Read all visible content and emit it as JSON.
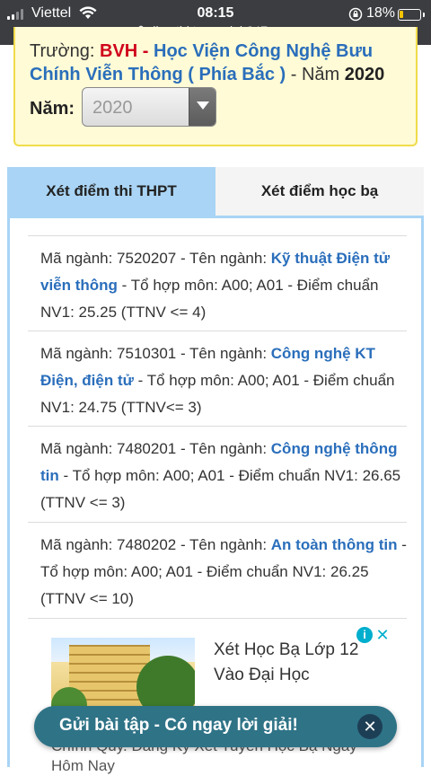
{
  "status_bar": {
    "carrier": "Viettel",
    "time": "08:15",
    "battery_percent": "18%",
    "battery_level": 0.18,
    "url": "diemthi.tuyensinh247.com"
  },
  "school": {
    "prefix": "Trường: ",
    "code": "BVH",
    "sep": " - ",
    "name": "Học Viện Công Nghệ Bưu Chính Viễn Thông ( Phía Bắc )",
    "year_prefix": " - Năm ",
    "year": "2020"
  },
  "year_select": {
    "label": "Năm:",
    "value": "2020"
  },
  "tabs": [
    {
      "label": "Xét điểm thi THPT",
      "active": true
    },
    {
      "label": "Xét điểm học bạ",
      "active": false
    }
  ],
  "majors": [
    {
      "code_text": "Mã ngành: 7520207 - Tên ngành: ",
      "name": "Kỹ thuật Điện tử viễn thông",
      "detail": " - Tổ hợp môn: A00; A01 - Điểm chuẩn NV1: 25.25 (TTNV <= 4)"
    },
    {
      "code_text": "Mã ngành: 7510301 - Tên ngành: ",
      "name": "Công nghệ KT Điện, điện tử",
      "detail": " - Tổ hợp môn: A00; A01 - Điểm chuẩn NV1: 24.75 (TTNV<= 3)"
    },
    {
      "code_text": "Mã ngành: 7480201 - Tên ngành: ",
      "name": "Công nghệ thông tin",
      "detail": " - Tổ hợp môn: A00; A01 - Điểm chuẩn NV1: 26.65 (TTNV <= 3)"
    },
    {
      "code_text": "Mã ngành: 7480202 - Tên ngành: ",
      "name": "An toàn thông tin",
      "detail": " - Tổ hợp môn: A00; A01 - Điểm chuẩn NV1: 26.25 (TTNV <= 10)"
    }
  ],
  "ad": {
    "title": "Xét Học Bạ Lớp 12 Vào Đại Học",
    "description": "Chính Quy. Đăng Ký Xét Tuyển Học Bạ Ngày Hôm Nay",
    "info_icon": "info-icon",
    "close_icon": "close-icon"
  },
  "banner": {
    "text": "Gửi bài tập - Có ngay lời giải!",
    "close_icon": "close-icon"
  }
}
